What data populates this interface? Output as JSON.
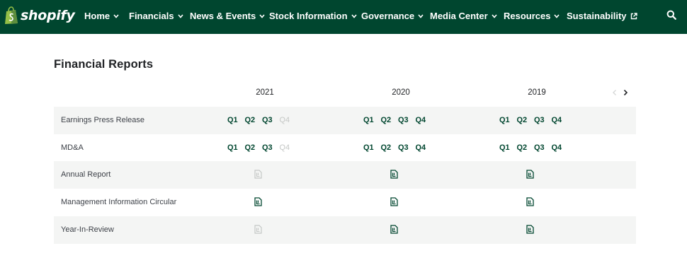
{
  "brand": {
    "name": "shopify",
    "logo_icon": "shopify-bag-icon"
  },
  "nav": {
    "items": [
      {
        "label": "Home"
      },
      {
        "label": "Financials"
      },
      {
        "label": "News & Events"
      },
      {
        "label": "Stock Information"
      },
      {
        "label": "Governance"
      },
      {
        "label": "Media Center"
      },
      {
        "label": "Resources"
      },
      {
        "label": "Sustainability",
        "icon": "external-link-icon"
      }
    ],
    "search_icon": "search-icon"
  },
  "page": {
    "title": "Financial Reports"
  },
  "table": {
    "years": [
      "2021",
      "2020",
      "2019"
    ],
    "pager": {
      "prev_enabled": false,
      "next_enabled": true
    },
    "quarters": [
      "Q1",
      "Q2",
      "Q3",
      "Q4"
    ],
    "rows": [
      {
        "label": "Earnings Press Release",
        "type": "quarters",
        "availability": [
          [
            true,
            true,
            true,
            false
          ],
          [
            true,
            true,
            true,
            true
          ],
          [
            true,
            true,
            true,
            true
          ]
        ]
      },
      {
        "label": "MD&A",
        "type": "quarters",
        "availability": [
          [
            true,
            true,
            true,
            false
          ],
          [
            true,
            true,
            true,
            true
          ],
          [
            true,
            true,
            true,
            true
          ]
        ]
      },
      {
        "label": "Annual Report",
        "type": "document",
        "availability": [
          false,
          true,
          true
        ]
      },
      {
        "label": "Management Information Circular",
        "type": "document",
        "availability": [
          true,
          true,
          true
        ]
      },
      {
        "label": "Year-In-Review",
        "type": "document",
        "availability": [
          false,
          true,
          true
        ]
      }
    ]
  },
  "colors": {
    "brand_dark_green": "#00462f",
    "row_shade": "#f4f5f4",
    "disabled": "#c4c7c5",
    "text": "#212326"
  }
}
